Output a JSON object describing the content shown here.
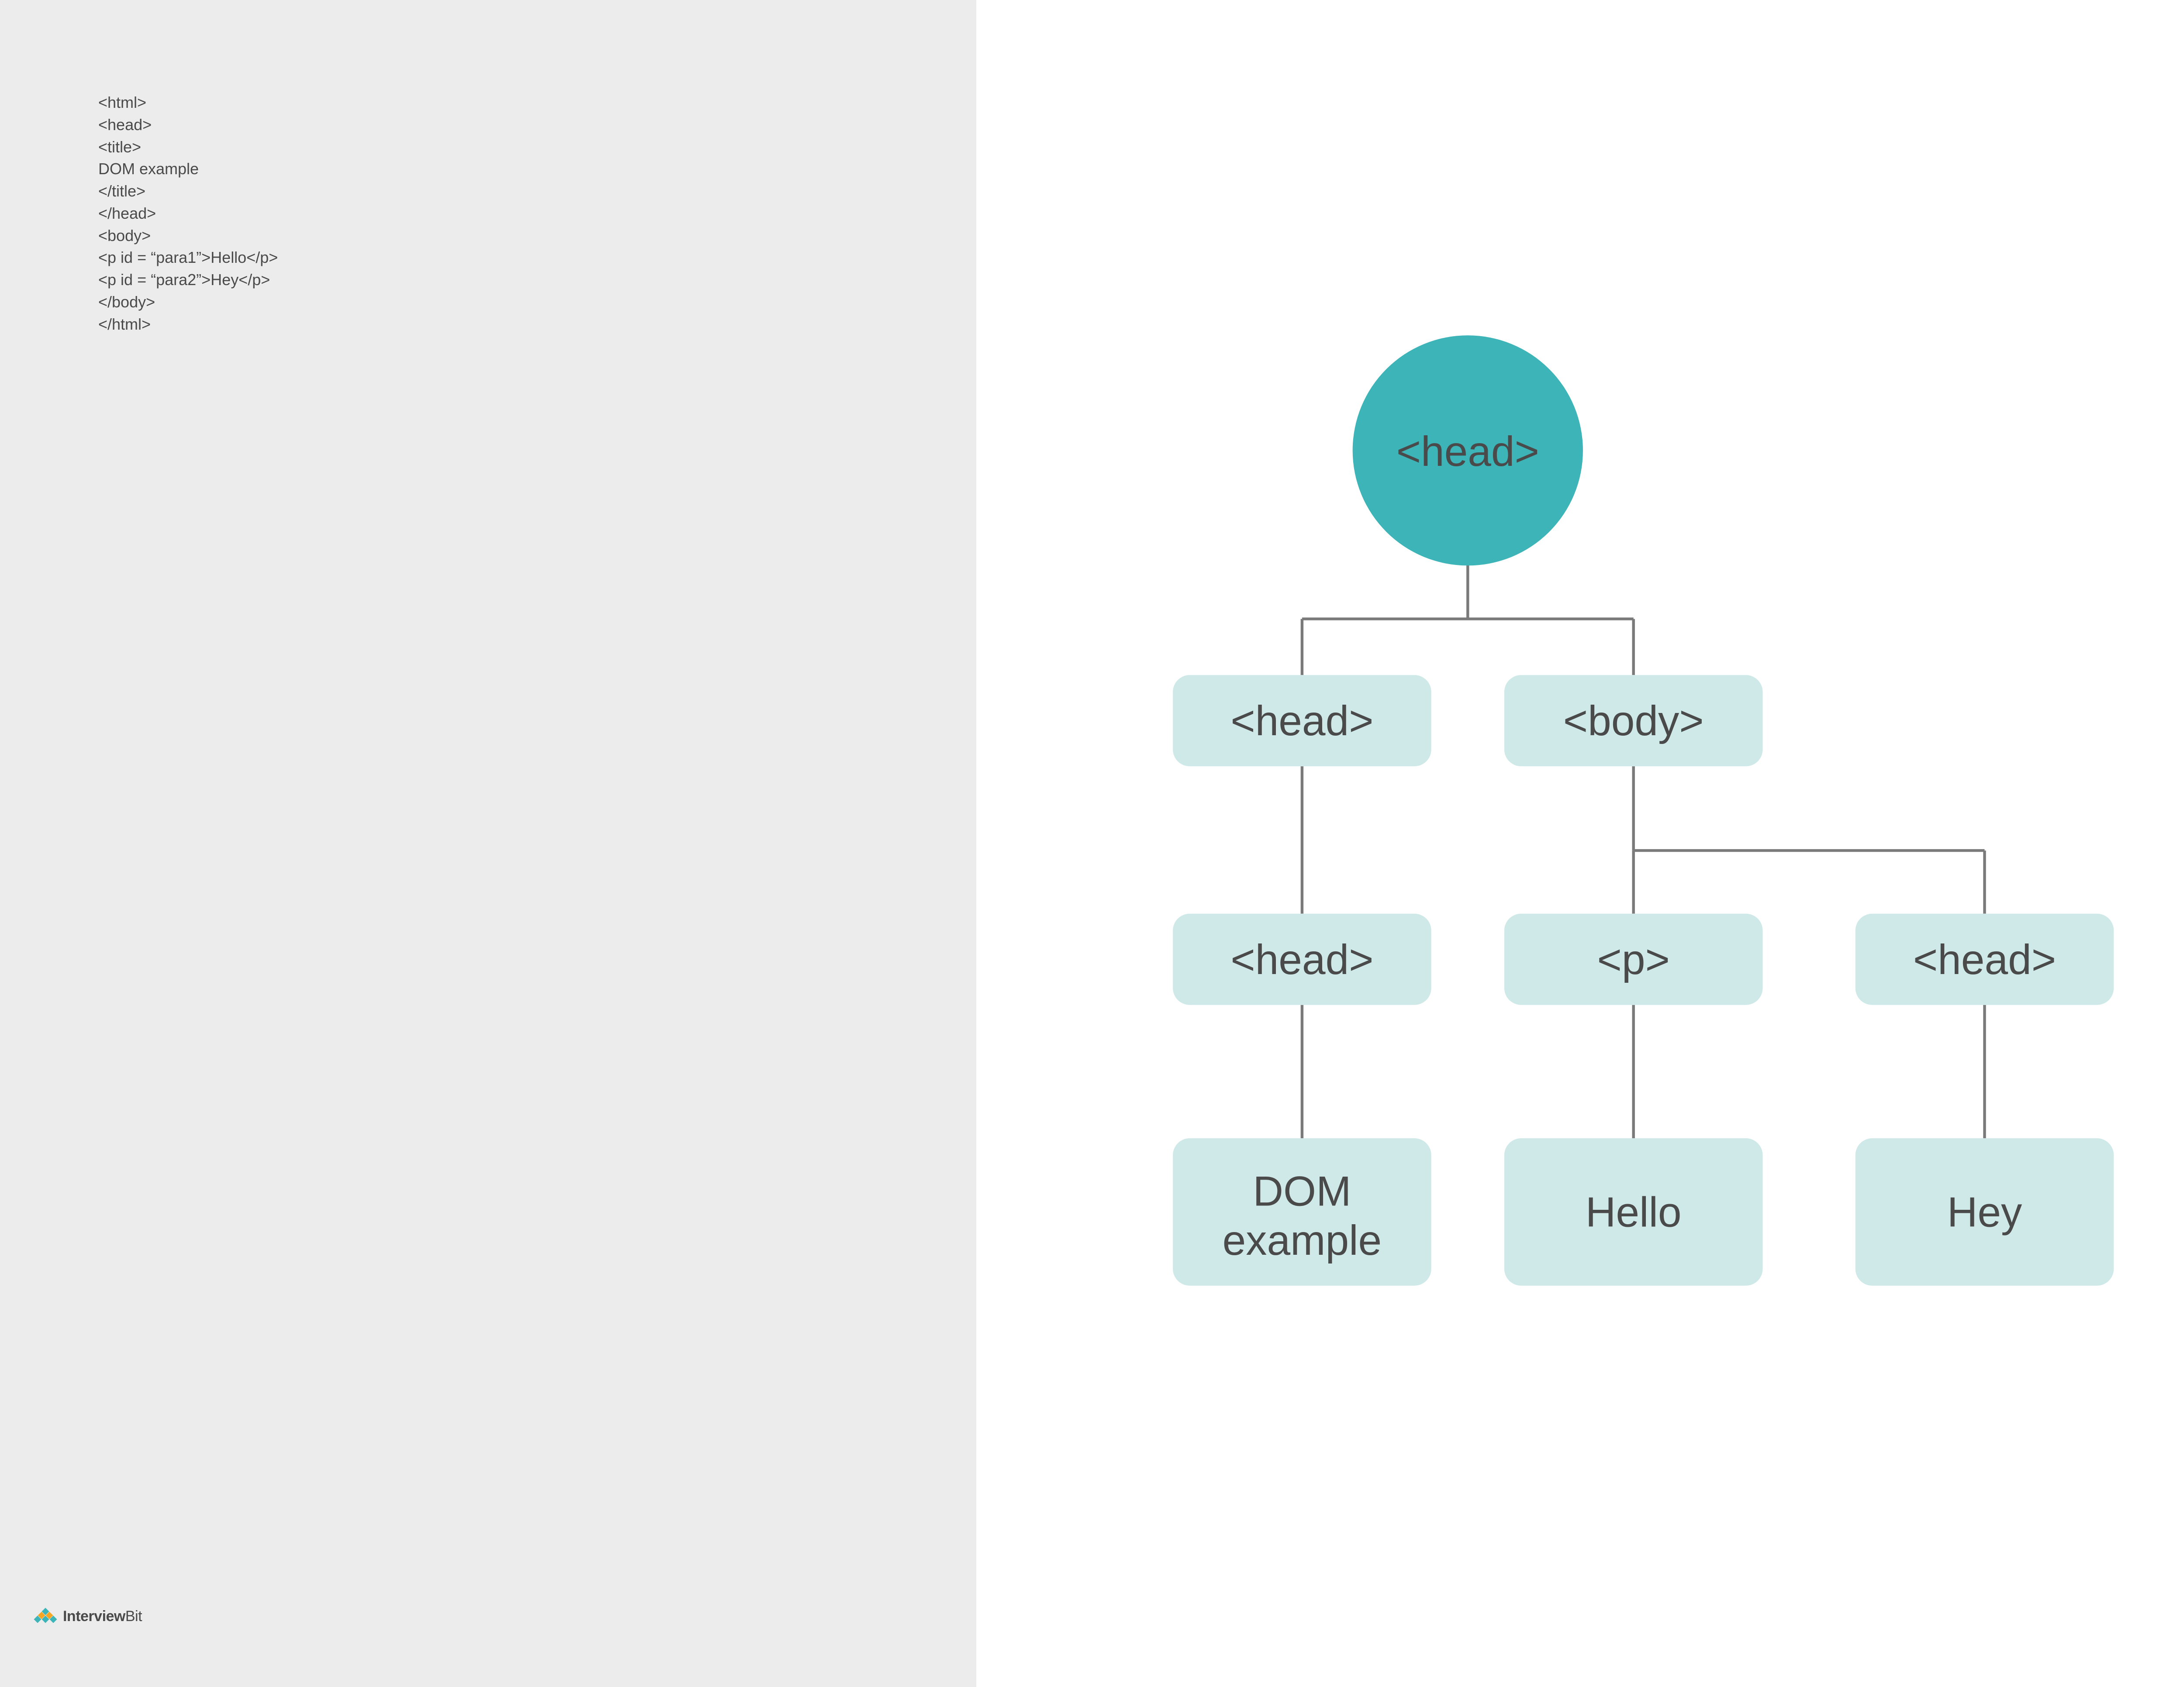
{
  "code": {
    "lines": [
      "<html>",
      "<head>",
      "<title>",
      "DOM example",
      "</title>",
      "</head>",
      "<body>",
      "<p id = “para1”>Hello</p>",
      "<p id = “para2”>Hey</p>",
      "</body>",
      "</html>"
    ]
  },
  "logo": {
    "bold": "Interview",
    "regular": "Bit"
  },
  "tree": {
    "root": {
      "label": "<head>"
    },
    "level2": {
      "left": "<head>",
      "right": "<body>"
    },
    "level3": {
      "a": "<head>",
      "b": "<p>",
      "c": "<head>"
    },
    "level4": {
      "a_line1": "DOM",
      "a_line2": "example",
      "b": "Hello",
      "c": "Hey"
    }
  },
  "colors": {
    "panel_bg": "#ececec",
    "text": "#4a4a4a",
    "root_node": "#3cb4b8",
    "child_node": "#cfe9e8",
    "edge": "#7a7a7a"
  }
}
